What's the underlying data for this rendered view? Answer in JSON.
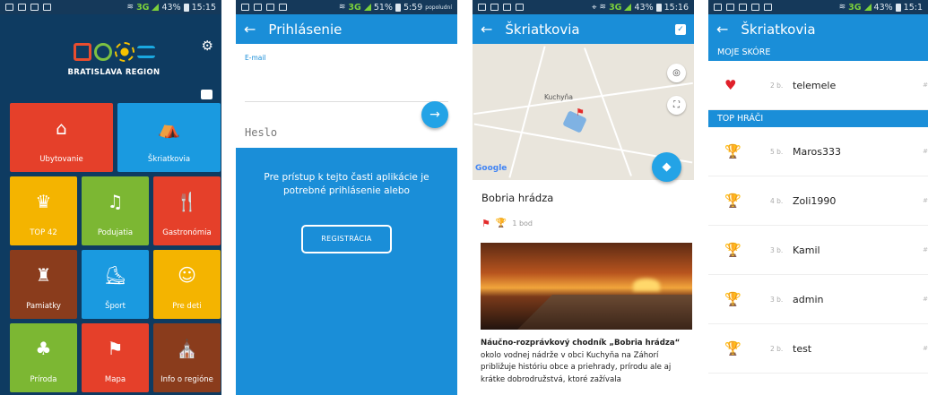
{
  "phone1": {
    "status": {
      "network": "3G",
      "battery": "43%",
      "time": "15:15"
    },
    "logo_text": "BRATISLAVA REGION",
    "tiles": [
      {
        "label": "Ubytovanie",
        "icon": "house-bed-icon",
        "glyph": "⌂",
        "color": "#e5402a"
      },
      {
        "label": "Škriatkovia",
        "icon": "dwarves-icon",
        "glyph": "⛺",
        "color": "#1a9ae0"
      },
      {
        "label": "TOP 42",
        "icon": "crown-icon",
        "glyph": "♛",
        "color": "#f4b400"
      },
      {
        "label": "Podujatia",
        "icon": "music-notes-icon",
        "glyph": "♫",
        "color": "#7cb733"
      },
      {
        "label": "Gastronómia",
        "icon": "fork-knife-icon",
        "glyph": "🍴",
        "color": "#e5402a"
      },
      {
        "label": "Pamiatky",
        "icon": "castle-icon",
        "glyph": "♜",
        "color": "#8a3c1c"
      },
      {
        "label": "Šport",
        "icon": "skate-icon",
        "glyph": "⛸",
        "color": "#1a9ae0"
      },
      {
        "label": "Pre deti",
        "icon": "teddy-bear-icon",
        "glyph": "☺",
        "color": "#f4b400"
      },
      {
        "label": "Príroda",
        "icon": "tree-icon",
        "glyph": "♣",
        "color": "#7cb733"
      },
      {
        "label": "Mapa",
        "icon": "map-flag-icon",
        "glyph": "⚑",
        "color": "#e5402a"
      },
      {
        "label": "Info o regióne",
        "icon": "church-icon",
        "glyph": "⛪",
        "color": "#8a3c1c"
      }
    ]
  },
  "phone2": {
    "status": {
      "network": "3G",
      "battery": "51%",
      "time": "5:59",
      "suffix": "popoludní"
    },
    "title": "Prihlásenie",
    "email_label": "E-mail",
    "password_placeholder": "Heslo",
    "access_text": "Pre prístup k tejto časti aplikácie je potrebné prihlásenie alebo",
    "register_label": "REGISTRÁCIA"
  },
  "phone3": {
    "status": {
      "network": "3G",
      "battery": "43%",
      "time": "15:16"
    },
    "title": "Škriatkovia",
    "map_town": "Kuchyňa",
    "map_brand": "Google",
    "place_title": "Bobria hrádza",
    "points": "1 bod",
    "desc_bold": "Náučno-rozprávkový chodník „Bobria hrádza“",
    "desc_rest": " okolo vodnej nádrže v obci Kuchyňa na Záhorí približuje históriu obce a priehrady, prírodu ale aj krátke dobrodružstvá, ktoré zažívala"
  },
  "phone4": {
    "status": {
      "network": "3G",
      "battery": "43%",
      "time": "15:1"
    },
    "title": "Škriatkovia",
    "my_score_header": "MOJE SKÓRE",
    "top_players_header": "TOP HRÁČI",
    "my_score": {
      "points": "2 b.",
      "name": "telemele",
      "rank": "#"
    },
    "players": [
      {
        "points": "5 b.",
        "name": "Maros333",
        "rank": "#",
        "color": "#f4b400"
      },
      {
        "points": "4 b.",
        "name": "Zoli1990",
        "rank": "#",
        "color": "#7cb733"
      },
      {
        "points": "3 b.",
        "name": "Kamil",
        "rank": "#",
        "color": "#8a3c1c"
      },
      {
        "points": "3 b.",
        "name": "admin",
        "rank": "#",
        "color": "#d0d0d0"
      },
      {
        "points": "2 b.",
        "name": "test",
        "rank": "#",
        "color": "#d0d0d0"
      }
    ]
  }
}
